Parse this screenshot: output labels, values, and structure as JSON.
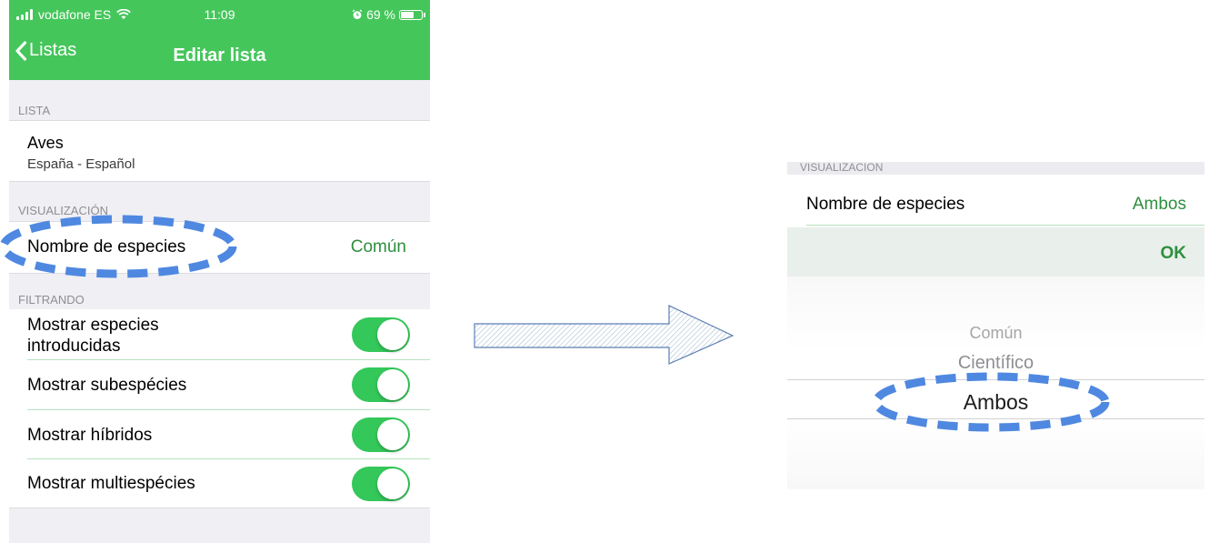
{
  "status_bar": {
    "carrier": "vodafone ES",
    "time": "11:09",
    "battery_text": "69 %",
    "battery_level": 0.69
  },
  "nav": {
    "back_label": "Listas",
    "title": "Editar lista"
  },
  "lista_section": {
    "header": "LISTA",
    "title": "Aves",
    "subtitle": "España - Español"
  },
  "visualizacion_section": {
    "header": "VISUALIZACIÓN",
    "row_label": "Nombre de especies",
    "row_value": "Común"
  },
  "filtrando_section": {
    "header": "FILTRANDO",
    "items": [
      {
        "label": "Mostrar especies introducidas",
        "on": true
      },
      {
        "label": "Mostrar subespécies",
        "on": true
      },
      {
        "label": "Mostrar híbridos",
        "on": true
      },
      {
        "label": "Mostrar multiespécies",
        "on": true
      }
    ]
  },
  "picker_panel": {
    "header": "VISUALIZACION",
    "row_label": "Nombre de especies",
    "row_value": "Ambos",
    "ok_label": "OK",
    "options": [
      "Común",
      "Científico",
      "Ambos"
    ],
    "selected": "Ambos"
  },
  "colors": {
    "brand_green": "#45c65b",
    "switch_green": "#34c759",
    "value_green": "#2d8f3e",
    "highlight_blue": "#4f88e0"
  }
}
